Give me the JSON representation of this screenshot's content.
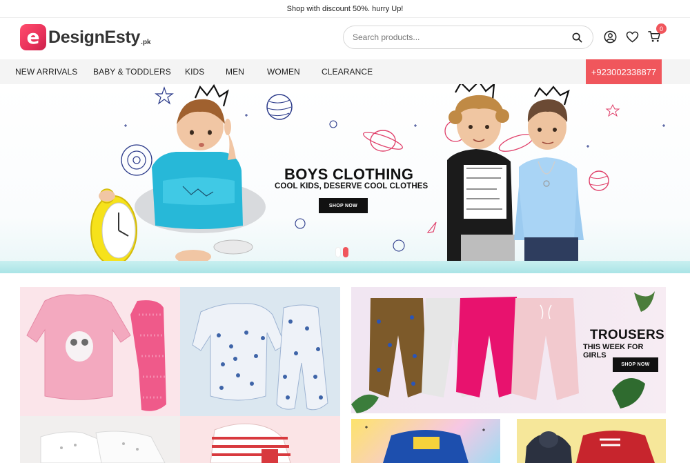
{
  "topbar": {
    "announcement": "Shop with discount 50%. hurry Up!"
  },
  "header": {
    "logo_mark": "e",
    "logo_text": "DesignEsty",
    "logo_suffix": ".pk",
    "search": {
      "placeholder": "Search products..."
    },
    "icons": [
      "search-icon",
      "user-icon",
      "heart-icon",
      "cart-icon"
    ],
    "cart_count": "0"
  },
  "nav": {
    "items": [
      {
        "label": "NEW ARRIVALS"
      },
      {
        "label": "BABY & TODDLERS"
      },
      {
        "label": "KIDS"
      },
      {
        "label": "MEN"
      },
      {
        "label": "WOMEN"
      },
      {
        "label": "CLEARANCE"
      }
    ],
    "phone": "+923002338877"
  },
  "hero": {
    "title": "BOYS CLOTHING",
    "subtitle": "COOL KIDS, DESERVE COOL CLOTHES",
    "cta": "SHOP NOW",
    "slides": 2,
    "active_slide": 2
  },
  "promo_trousers": {
    "title": "TROUSERS",
    "subtitle": "THIS WEEK FOR GIRLS",
    "cta": "SHOP NOW"
  },
  "colors": {
    "accent": "#f0565c",
    "brand": "#e8315a",
    "nav_bg": "#f4f4f4",
    "dark": "#111111"
  }
}
